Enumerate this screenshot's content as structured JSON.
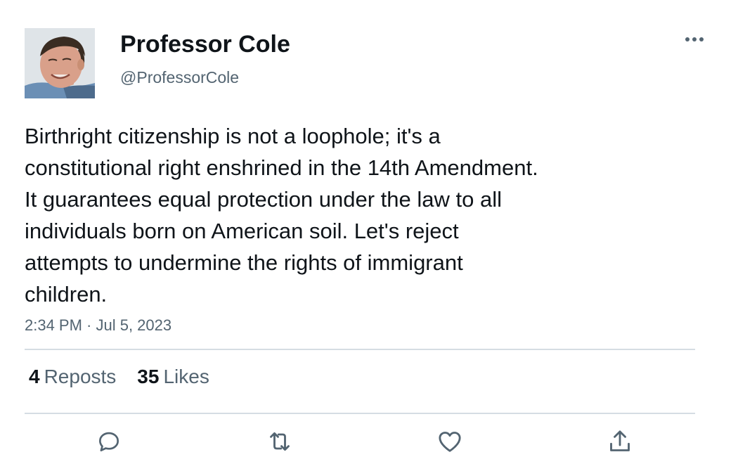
{
  "author": {
    "display_name": "Professor Cole",
    "handle": "@ProfessorCole",
    "avatar_icon": "person-photo-avatar"
  },
  "tweet": {
    "text": "Birthright citizenship is not a loophole; it's a\nconstitutional right enshrined in the 14th Amendment.\nIt guarantees equal protection under the law to all\nindividuals born on American soil. Let's reject\nattempts to undermine the rights of immigrant\nchildren.",
    "timestamp": "2:34 PM · Jul 5, 2023"
  },
  "stats": {
    "reposts_count": "4",
    "reposts_label": "Reposts",
    "likes_count": "35",
    "likes_label": "Likes"
  },
  "actions": [
    {
      "icon": "reply-icon"
    },
    {
      "icon": "repost-icon"
    },
    {
      "icon": "like-icon"
    },
    {
      "icon": "share-icon"
    }
  ],
  "colors": {
    "text_primary": "#0f1419",
    "text_secondary": "#536471",
    "divider": "#d5dde3"
  }
}
